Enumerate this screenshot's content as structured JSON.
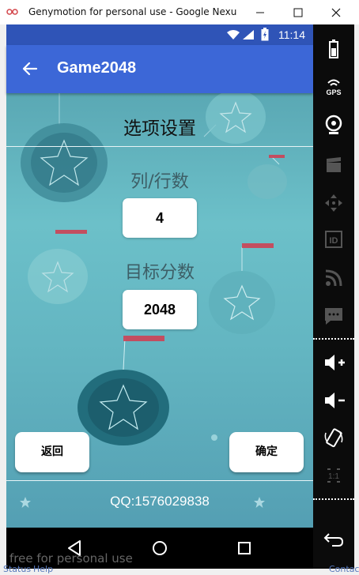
{
  "window": {
    "title": "Genymotion for personal use - Google Nexu"
  },
  "status_bar": {
    "time": "11:14"
  },
  "app_bar": {
    "title": "Game2048"
  },
  "settings": {
    "heading": "选项设置",
    "grid_label": "列/行数",
    "grid_value": "4",
    "target_label": "目标分数",
    "target_value": "2048"
  },
  "buttons": {
    "back": "返回",
    "confirm": "确定"
  },
  "footer": {
    "contact": "QQ:1576029838"
  },
  "sidebar_icons": [
    "battery-icon",
    "gps-icon",
    "camera-icon",
    "clapper-icon",
    "dpad-icon",
    "id-icon",
    "rss-icon",
    "message-icon",
    "volume-up-icon",
    "volume-down-icon",
    "rotate-icon",
    "scale-icon",
    "back-arrow-icon"
  ],
  "sidebar_labels": {
    "gps": "GPS",
    "id": "ID",
    "scale": "1:1"
  },
  "background_text": {
    "watermark": "free for personal use",
    "status": "Status",
    "help": "Help",
    "contact": "Contact"
  },
  "colors": {
    "status_bar": "#2f54b7",
    "app_bar": "#3c67d7",
    "background": "#63b5c1"
  }
}
